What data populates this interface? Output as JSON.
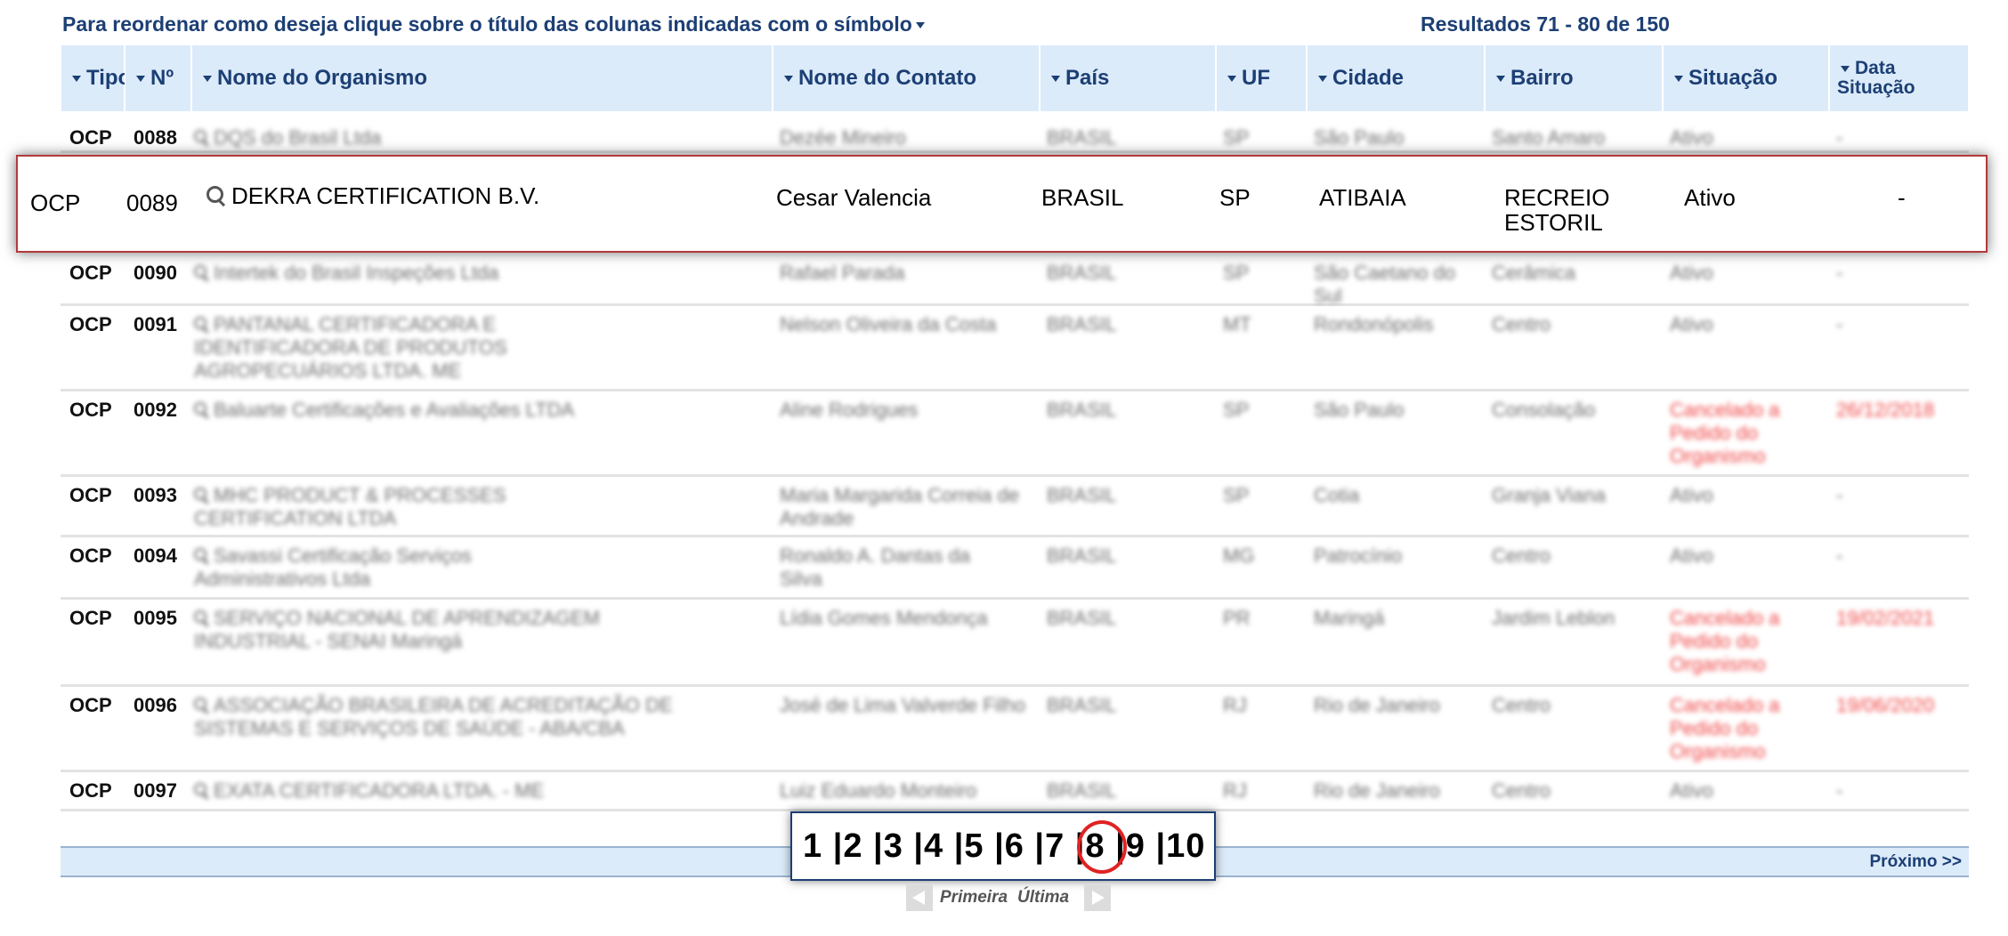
{
  "header_note": "Para reordenar como deseja clique sobre o título das colunas indicadas com o símbolo",
  "results": "Resultados 71 - 80 de 150",
  "columns": {
    "tipo": "Tipo",
    "numero": "Nº",
    "organismo": "Nome do Organismo",
    "contato": "Nome do Contato",
    "pais": "País",
    "uf": "UF",
    "cidade": "Cidade",
    "bairro": "Bairro",
    "situacao": "Situação",
    "data_line1": "Data",
    "data_line2": "Situação"
  },
  "highlighted": {
    "tipo": "OCP",
    "numero": "0089",
    "organismo": "DEKRA CERTIFICATION B.V.",
    "contato": "Cesar Valencia",
    "pais": "BRASIL",
    "uf": "SP",
    "cidade": "ATIBAIA",
    "bairro_line1": "RECREIO",
    "bairro_line2": "ESTORIL",
    "situacao": "Ativo",
    "data": "-"
  },
  "rows": [
    {
      "tipo": "OCP",
      "numero": "0088",
      "organismo": "DQS do Brasil Ltda",
      "contato": "Dezée Mineiro",
      "pais": "BRASIL",
      "uf": "SP",
      "cidade": "São Paulo",
      "bairro": "Santo Amaro",
      "situacao": "Ativo",
      "data": "-"
    },
    {
      "tipo": "OCP",
      "numero": "0090",
      "organismo": "Intertek do Brasil Inspeções Ltda",
      "contato": "Rafael Parada",
      "pais": "BRASIL",
      "uf": "SP",
      "cidade": "São Caetano do Sul",
      "bairro": "Cerâmica",
      "situacao": "Ativo",
      "data": "-"
    },
    {
      "tipo": "OCP",
      "numero": "0091",
      "organismo": "PANTANAL CERTIFICADORA E IDENTIFICADORA DE PRODUTOS AGROPECUÁRIOS LTDA. ME",
      "contato": "Nelson Oliveira da Costa",
      "pais": "BRASIL",
      "uf": "MT",
      "cidade": "Rondonópolis",
      "bairro": "Centro",
      "situacao": "Ativo",
      "data": "-"
    },
    {
      "tipo": "OCP",
      "numero": "0092",
      "organismo": "Baluarte Certificações e Avaliações LTDA",
      "contato": "Aline Rodrigues",
      "pais": "BRASIL",
      "uf": "SP",
      "cidade": "São Paulo",
      "bairro": "Consolação",
      "situacao": "Cancelado a Pedido do Organismo",
      "data": "26/12/2018"
    },
    {
      "tipo": "OCP",
      "numero": "0093",
      "organismo": "MHC PRODUCT & PROCESSES CERTIFICATION LTDA",
      "contato": "Maria Margarida Correia de Andrade",
      "pais": "BRASIL",
      "uf": "SP",
      "cidade": "Cotia",
      "bairro": "Granja Viana",
      "situacao": "Ativo",
      "data": "-"
    },
    {
      "tipo": "OCP",
      "numero": "0094",
      "organismo": "Savassi Certificação Serviços Administrativos Ltda",
      "contato": "Ronaldo A. Dantas da Silva",
      "pais": "BRASIL",
      "uf": "MG",
      "cidade": "Patrocínio",
      "bairro": "Centro",
      "situacao": "Ativo",
      "data": "-"
    },
    {
      "tipo": "OCP",
      "numero": "0095",
      "organismo": "SERVIÇO NACIONAL DE APRENDIZAGEM INDUSTRIAL - SENAI Maringá",
      "contato": "Lídia Gomes Mendonça",
      "pais": "BRASIL",
      "uf": "PR",
      "cidade": "Maringá",
      "bairro": "Jardim Leblon",
      "situacao": "Cancelado a Pedido do Organismo",
      "data": "19/02/2021"
    },
    {
      "tipo": "OCP",
      "numero": "0096",
      "organismo": "ASSOCIAÇÃO BRASILEIRA DE ACREDITAÇÃO DE SISTEMAS E SERVIÇOS DE SAÚDE - ABA/CBA",
      "contato": "José de Lima Valverde Filho",
      "pais": "BRASIL",
      "uf": "RJ",
      "cidade": "Rio de Janeiro",
      "bairro": "Centro",
      "situacao": "Cancelado a Pedido do Organismo",
      "data": "19/06/2020"
    },
    {
      "tipo": "OCP",
      "numero": "0097",
      "organismo": "EXATA CERTIFICADORA LTDA. - ME",
      "contato": "Luiz Eduardo Monteiro",
      "pais": "BRASIL",
      "uf": "RJ",
      "cidade": "Rio de Janeiro",
      "bairro": "Centro",
      "situacao": "Ativo",
      "data": "-"
    }
  ],
  "pager": {
    "pages": [
      "1",
      "2",
      "3",
      "4",
      "5",
      "6",
      "7",
      "8",
      "9",
      "10"
    ],
    "selected": "8",
    "next": "Próximo >>",
    "first": "Primeira",
    "last": "Última"
  },
  "colors": {
    "header_bg": "#dcebfa",
    "header_text": "#1c3f74",
    "cancelled": "#f04545",
    "highlight_border": "#b33a3a",
    "circle": "#e12222"
  }
}
